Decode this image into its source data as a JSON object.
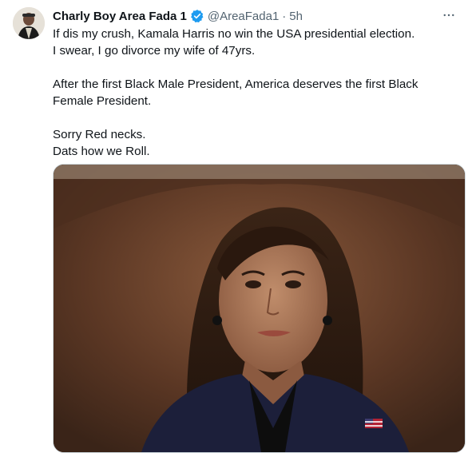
{
  "tweet": {
    "author_name": "Charly Boy Area Fada 1",
    "handle": "@AreaFada1",
    "separator": "·",
    "time": "5h",
    "lines": [
      "If dis my crush, Kamala Harris no win the USA presidential election.",
      "I swear, I go divorce my wife of 47yrs.",
      "",
      "After the first Black Male President, America deserves the first Black",
      "Female President.",
      "",
      "Sorry Red necks.",
      "Dats how we Roll."
    ],
    "more_icon": "ellipsis-icon",
    "verified_icon": "verified-badge-icon",
    "verified_color": "#1d9bf0"
  },
  "colors": {
    "text": "#0f1419",
    "secondary": "#536471"
  }
}
